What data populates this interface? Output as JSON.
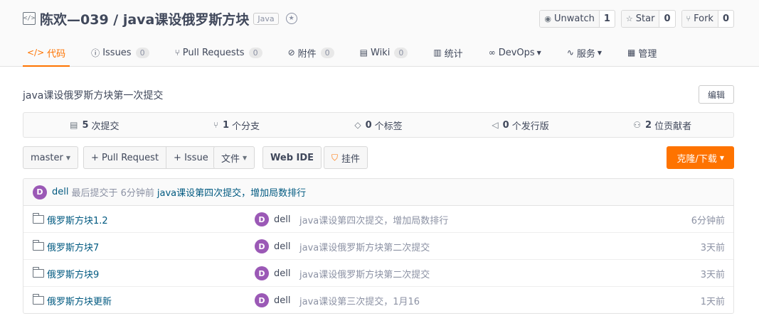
{
  "repo": {
    "title": "陈欢—039 / java课设俄罗斯方块",
    "language": "Java",
    "icon": "repo-icon",
    "award_icon": "award-icon"
  },
  "actions": [
    {
      "label": "Unwatch",
      "count": "1",
      "icon": "eye-icon",
      "glyph": "◉"
    },
    {
      "label": "Star",
      "count": "0",
      "icon": "star-icon",
      "glyph": "☆"
    },
    {
      "label": "Fork",
      "count": "0",
      "icon": "fork-icon",
      "glyph": "⑂"
    }
  ],
  "tabs": [
    {
      "label": "代码",
      "glyph": "</>",
      "icon": "code-icon",
      "badge": "",
      "caret": false,
      "active": true
    },
    {
      "label": "Issues",
      "glyph": "ⓘ",
      "icon": "issues-icon",
      "badge": "0",
      "caret": false,
      "active": false
    },
    {
      "label": "Pull Requests",
      "glyph": "⑂",
      "icon": "pull-request-icon",
      "badge": "0",
      "caret": false,
      "active": false
    },
    {
      "label": "附件",
      "glyph": "⊘",
      "icon": "attachment-icon",
      "badge": "0",
      "caret": false,
      "active": false
    },
    {
      "label": "Wiki",
      "glyph": "▤",
      "icon": "wiki-icon",
      "badge": "0",
      "caret": false,
      "active": false
    },
    {
      "label": "统计",
      "glyph": "▥",
      "icon": "stats-icon",
      "badge": "",
      "caret": false,
      "active": false
    },
    {
      "label": "DevOps",
      "glyph": "∞",
      "icon": "devops-icon",
      "badge": "",
      "caret": true,
      "active": false
    },
    {
      "label": "服务",
      "glyph": "∿",
      "icon": "service-icon",
      "badge": "",
      "caret": true,
      "active": false
    },
    {
      "label": "管理",
      "glyph": "▦",
      "icon": "manage-icon",
      "badge": "",
      "caret": false,
      "active": false
    }
  ],
  "description": "java课设俄罗斯方块第一次提交",
  "edit_label": "编辑",
  "stats": [
    {
      "count": "5",
      "label": "次提交",
      "icon": "commits-icon",
      "glyph": "▤"
    },
    {
      "count": "1",
      "label": "个分支",
      "icon": "branch-icon",
      "glyph": "⑂"
    },
    {
      "count": "0",
      "label": "个标签",
      "icon": "tag-icon",
      "glyph": "◇"
    },
    {
      "count": "0",
      "label": "个发行版",
      "icon": "release-icon",
      "glyph": "◁"
    },
    {
      "count": "2",
      "label": "位贡献者",
      "icon": "contributors-icon",
      "glyph": "⚇"
    }
  ],
  "toolbar": {
    "branch": "master",
    "pull_request": "+ Pull Request",
    "issue": "+ Issue",
    "file": "文件",
    "web_ide": "Web IDE",
    "widget": "挂件",
    "widget_icon": "bookmark-icon",
    "clone": "克隆/下载",
    "accent": "#fe7300"
  },
  "last_commit": {
    "avatar": "D",
    "author": "dell",
    "text": "最后提交于 6分钟前",
    "message": "java课设第四次提交，增加局数排行"
  },
  "files": [
    {
      "name": "俄罗斯方块1.2",
      "avatar": "D",
      "author": "dell",
      "message": "java课设第四次提交，增加局数排行",
      "time": "6分钟前"
    },
    {
      "name": "俄罗斯方块7",
      "avatar": "D",
      "author": "dell",
      "message": "java课设俄罗斯方块第二次提交",
      "time": "3天前"
    },
    {
      "name": "俄罗斯方块9",
      "avatar": "D",
      "author": "dell",
      "message": "java课设俄罗斯方块第二次提交",
      "time": "3天前"
    },
    {
      "name": "俄罗斯方块更新",
      "avatar": "D",
      "author": "dell",
      "message": "java课设第三次提交，1月16",
      "time": "1天前"
    }
  ]
}
